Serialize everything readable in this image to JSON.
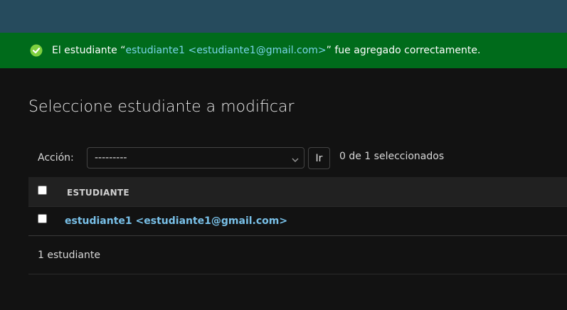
{
  "message": {
    "prefix": "El estudiante “",
    "object": "estudiante1 <estudiante1@gmail.com>",
    "suffix": "” fue agregado correctamente."
  },
  "page_title": "Seleccione estudiante a modificar",
  "actions": {
    "label": "Acción:",
    "selected_option": "---------",
    "go_button": "Ir",
    "selection_count": "0 de 1 seleccionados"
  },
  "table": {
    "column_header": "ESTUDIANTE",
    "rows": [
      {
        "label": "estudiante1 <estudiante1@gmail.com>"
      }
    ]
  },
  "result_count": "1 estudiante",
  "colors": {
    "header_bg": "#264b5d",
    "success_bg": "#006b1b",
    "link": "#79c0e8"
  }
}
